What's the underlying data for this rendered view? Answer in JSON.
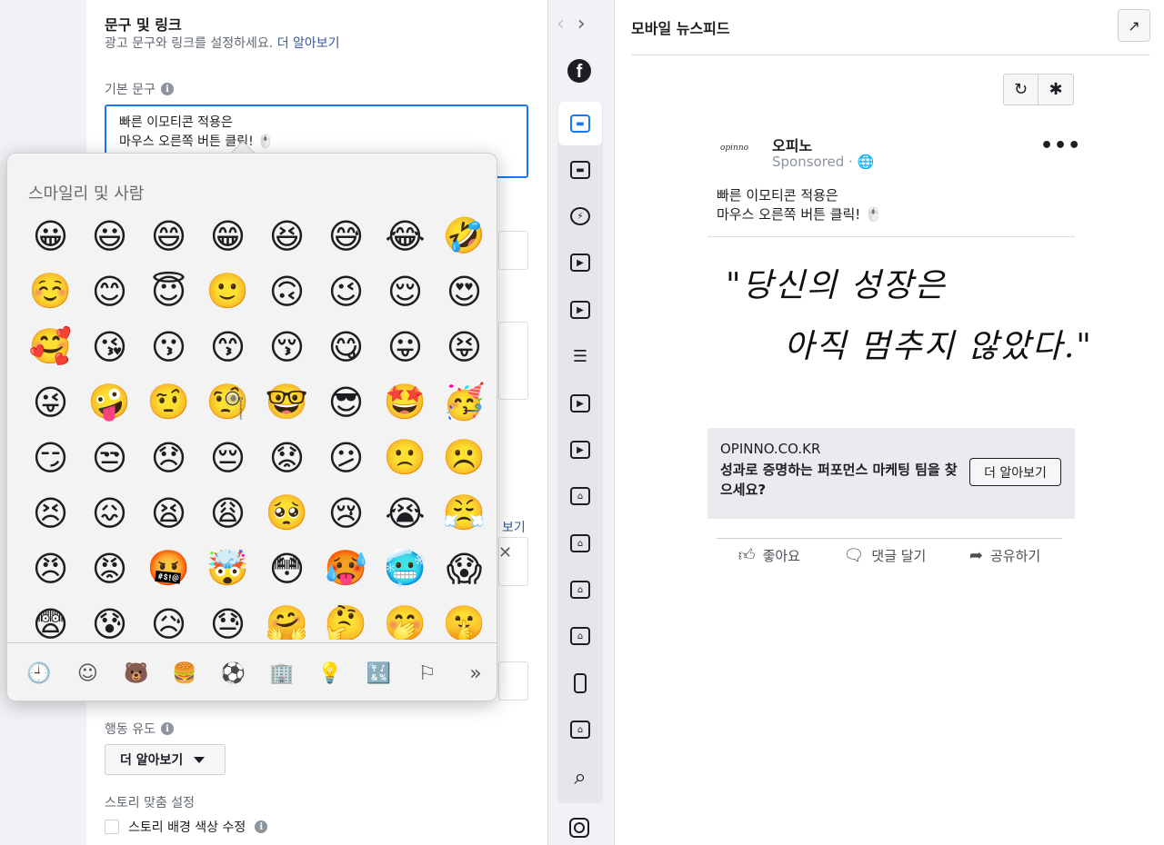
{
  "editor": {
    "section_title": "문구 및 링크",
    "section_desc": "광고 문구와 링크를 설정하세요.",
    "learn_more_link": "더 알아보기",
    "primary_text_label": "기본 문구",
    "primary_text_line1": "빠른 이모티콘 적용은",
    "primary_text_line2": "마우스 오른쪽 버튼 클릭! 🖱️",
    "partial_link": "보기",
    "close_symbol": "✕",
    "cta_label": "행동 유도",
    "cta_value": "더 알아보기",
    "story_label": "스토리 맞춤 설정",
    "story_checkbox_label": "스토리 배경 색상 수정"
  },
  "emoji_picker": {
    "heading": "스마일리 및 사람",
    "emojis": [
      "😀",
      "😃",
      "😄",
      "😁",
      "😆",
      "😅",
      "😂",
      "🤣",
      "☺️",
      "😊",
      "😇",
      "🙂",
      "🙃",
      "😉",
      "😌",
      "😍",
      "🥰",
      "😘",
      "😗",
      "😙",
      "😚",
      "😋",
      "😛",
      "😝",
      "😜",
      "🤪",
      "🤨",
      "🧐",
      "🤓",
      "😎",
      "🤩",
      "🥳",
      "😏",
      "😒",
      "😞",
      "😔",
      "😟",
      "😕",
      "🙁",
      "☹️",
      "😣",
      "😖",
      "😫",
      "😩",
      "🥺",
      "😢",
      "😭",
      "😤",
      "😠",
      "😡",
      "🤬",
      "🤯",
      "😳",
      "🥵",
      "🥶",
      "😱",
      "😨",
      "😰",
      "😥",
      "😓",
      "🤗",
      "🤔",
      "🤭",
      "🤫"
    ],
    "categories": [
      {
        "name": "recent-icon",
        "glyph": "🕘"
      },
      {
        "name": "smiley-icon",
        "glyph": "☺"
      },
      {
        "name": "animal-icon",
        "glyph": "🐻"
      },
      {
        "name": "food-icon",
        "glyph": "🍔"
      },
      {
        "name": "activity-icon",
        "glyph": "⚽"
      },
      {
        "name": "travel-icon",
        "glyph": "🏢"
      },
      {
        "name": "objects-icon",
        "glyph": "💡"
      },
      {
        "name": "symbols-icon",
        "glyph": "🔣"
      },
      {
        "name": "flags-icon",
        "glyph": "⚐"
      },
      {
        "name": "more-icon",
        "glyph": "»"
      }
    ]
  },
  "nav": {
    "back_arrow": "‹",
    "forward_arrow": "›",
    "fb_letter": "f"
  },
  "preview": {
    "title": "모바일 뉴스피드",
    "post": {
      "avatar_text": "opinno",
      "name": "오피노",
      "sponsored": "Sponsored · 🌐",
      "more": "•••",
      "text_line1": "빠른 이모티콘 적용은",
      "text_line2": "마우스 오른쪽 버튼 클릭! 🖱️",
      "image_line1": "\"당신의 성장은",
      "image_line2": "아직 멈추지 않았다.\""
    },
    "link": {
      "domain": "OPINNO.CO.KR",
      "headline": "성과로 증명하는 퍼포먼스 마케팅 팀을 찾으세요?",
      "button": "더 알아보기"
    },
    "actions": {
      "like": "좋아요",
      "comment": "댓글 달기",
      "share": "공유하기"
    }
  },
  "colors": {
    "accent": "#1877f2",
    "link": "#385898"
  }
}
